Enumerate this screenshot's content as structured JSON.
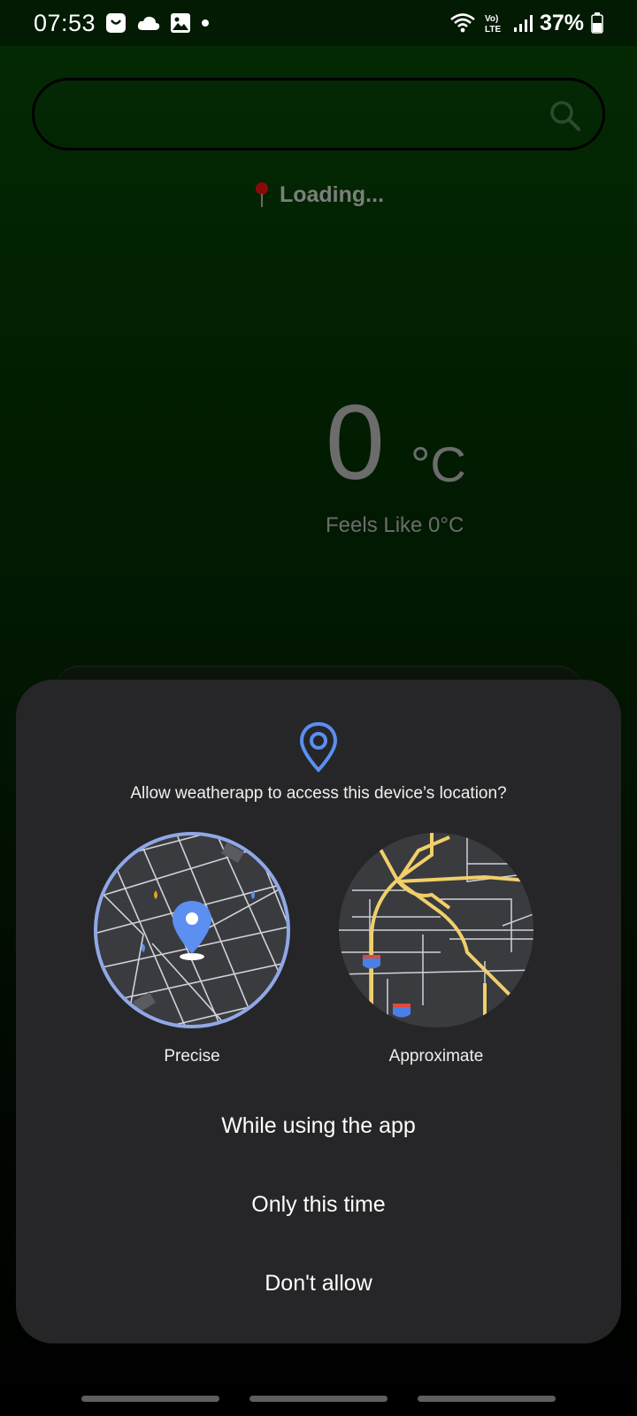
{
  "status_bar": {
    "time": "07:53",
    "network_label": "Vo) LTE",
    "battery": "37%"
  },
  "search": {
    "placeholder": "",
    "value": ""
  },
  "location": {
    "text": "Loading..."
  },
  "weather": {
    "temperature": "0",
    "unit": "°C",
    "feels_like": "Feels Like 0°C"
  },
  "permission_dialog": {
    "title": "Allow weatherapp to access this device’s location?",
    "options": [
      {
        "label": "Precise",
        "selected": true
      },
      {
        "label": "Approximate",
        "selected": false
      }
    ],
    "buttons": {
      "while_using": "While using the app",
      "only_this_time": "Only this time",
      "dont_allow": "Don't allow"
    }
  },
  "colors": {
    "accent": "#5b8ff0",
    "selection_ring": "#8fa8e8",
    "dialog_bg": "#262628",
    "app_bg": "#032b03"
  }
}
